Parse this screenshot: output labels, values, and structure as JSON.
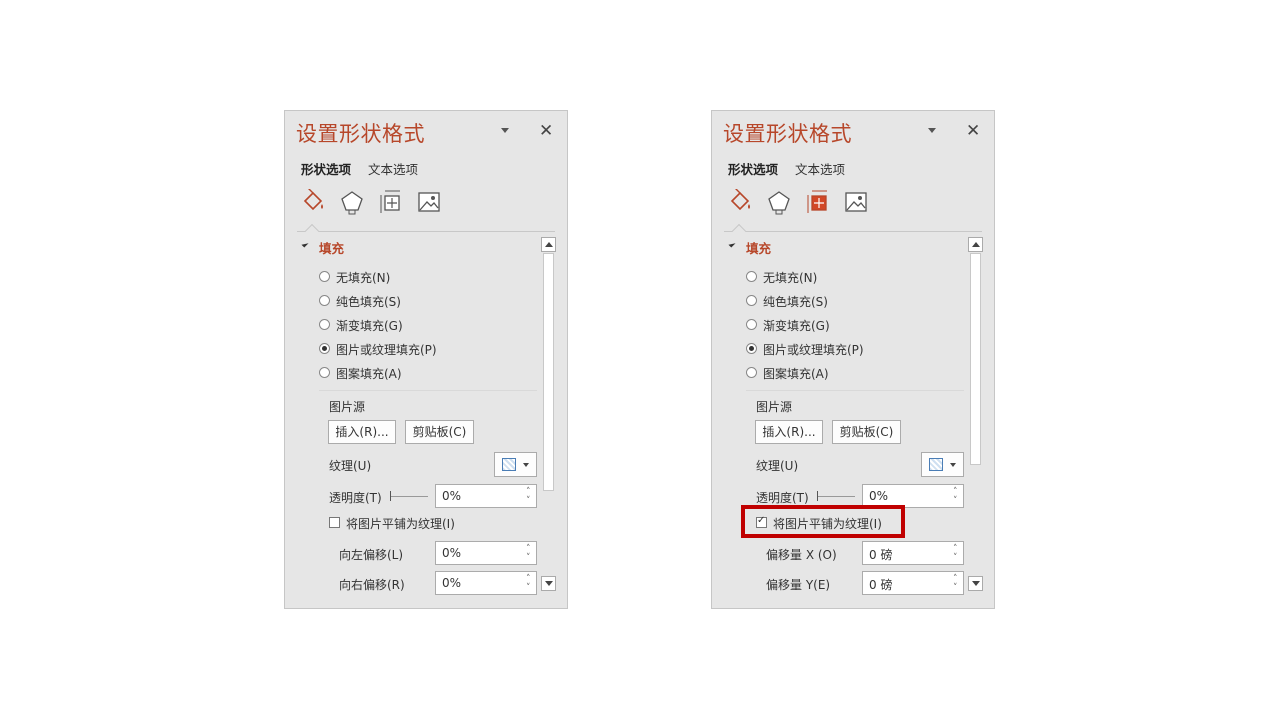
{
  "panels": [
    {
      "title": "设置形状格式",
      "tabs": [
        "形状选项",
        "文本选项"
      ],
      "section_title": "填充",
      "fill_options": [
        {
          "label": "无填充(N)",
          "checked": false
        },
        {
          "label": "纯色填充(S)",
          "checked": false
        },
        {
          "label": "渐变填充(G)",
          "checked": false
        },
        {
          "label": "图片或纹理填充(P)",
          "checked": true
        },
        {
          "label": "图案填充(A)",
          "checked": false
        }
      ],
      "picture_source_label": "图片源",
      "insert_button": "插入(R)...",
      "clipboard_button": "剪贴板(C)",
      "texture_label": "纹理(U)",
      "transparency_label": "透明度(T)",
      "transparency_value": "0%",
      "tile_checkbox_label": "将图片平铺为纹理(I)",
      "tile_checked": false,
      "offset_rows": [
        {
          "label": "向左偏移(L)",
          "value": "0%"
        },
        {
          "label": "向右偏移(R)",
          "value": "0%"
        }
      ]
    },
    {
      "title": "设置形状格式",
      "tabs": [
        "形状选项",
        "文本选项"
      ],
      "section_title": "填充",
      "fill_options": [
        {
          "label": "无填充(N)",
          "checked": false
        },
        {
          "label": "纯色填充(S)",
          "checked": false
        },
        {
          "label": "渐变填充(G)",
          "checked": false
        },
        {
          "label": "图片或纹理填充(P)",
          "checked": true
        },
        {
          "label": "图案填充(A)",
          "checked": false
        }
      ],
      "picture_source_label": "图片源",
      "insert_button": "插入(R)...",
      "clipboard_button": "剪贴板(C)",
      "texture_label": "纹理(U)",
      "transparency_label": "透明度(T)",
      "transparency_value": "0%",
      "tile_checkbox_label": "将图片平铺为纹理(I)",
      "tile_checked": true,
      "offset_rows": [
        {
          "label": "偏移量 X (O)",
          "value": "0 磅"
        },
        {
          "label": "偏移量 Y(E)",
          "value": "0 磅"
        }
      ]
    }
  ],
  "icons": [
    "fill-bucket-icon",
    "pentagon-icon",
    "size-layout-icon",
    "picture-icon"
  ],
  "colors": {
    "accent": "#b7472a",
    "highlight_box": "#c00000",
    "panel_bg": "#e6e6e6"
  }
}
